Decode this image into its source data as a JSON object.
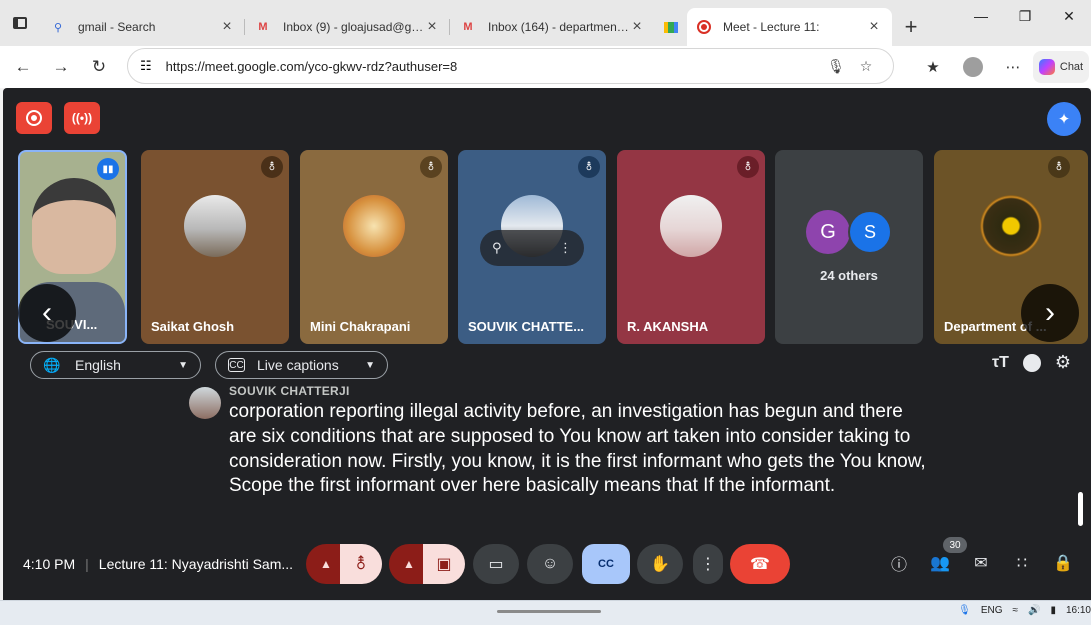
{
  "browser": {
    "tabs": [
      {
        "title": "gmail - Search",
        "icon": "search-icon"
      },
      {
        "title": "Inbox (9) - gloajusad@gmail.com",
        "icon": "gmail-icon"
      },
      {
        "title": "Inbox (164) - departmentofl",
        "icon": "gmail-icon"
      },
      {
        "title": "Meet - Lecture 11:",
        "icon": "record-icon",
        "active": true
      }
    ],
    "url": "https://meet.google.com/yco-gkwv-rdz?authuser=8",
    "chat_label": "Chat"
  },
  "meet": {
    "participants": [
      {
        "name": "SOUVI...",
        "mic": "speaking",
        "bg": "#a7b18f",
        "frame": "#8ab4f8"
      },
      {
        "name": "Saikat Ghosh",
        "mic": "muted",
        "bg": "#7a5230"
      },
      {
        "name": "Mini Chakrapani",
        "mic": "muted",
        "bg": "#8a6a3f"
      },
      {
        "name": "SOUVIK CHATTE...",
        "mic": "muted",
        "bg": "#3c5d84"
      },
      {
        "name": "R. AKANSHA",
        "mic": "muted",
        "bg": "#943644"
      },
      {
        "name": "",
        "others": "24 others",
        "initials": [
          "G",
          "S"
        ],
        "bg": "#3c4043"
      },
      {
        "name": "Department of ...",
        "mic": "muted",
        "bg": "#6c5327"
      }
    ],
    "captions": {
      "language": "English",
      "mode": "Live captions",
      "speaker": "SOUVIK CHATTERJI",
      "text": "corporation reporting illegal activity before, an investigation has begun and there are six conditions that are supposed to You know art taken into consider taking to consideration now. Firstly, you know, it is the first informant who gets the You know, Scope the first informant over here basically means that If the informant."
    },
    "time": "4:10 PM",
    "meeting_title": "Lecture 11: Nyayadrishti Sam...",
    "people_count": "30"
  },
  "taskbar": {
    "lang": "ENG",
    "clock": "16:10"
  },
  "colors": {
    "stage": "#202124",
    "leave": "#ea4335",
    "cc_active": "#a8c7fa"
  }
}
